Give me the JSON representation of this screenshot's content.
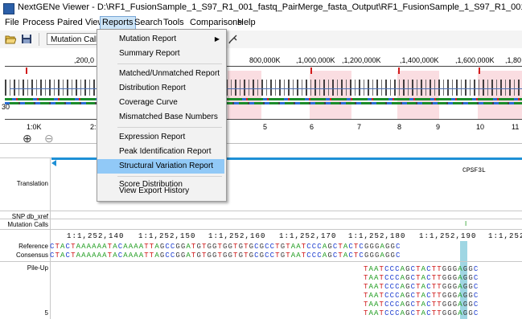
{
  "window": {
    "title": "NextGENe Viewer - D:\\RF1_FusionSample_1_S97_R1_001_fastq_PairMerge_fasta_Output\\RF1_FusionSample_1_S97_R1_001_fastq_PairMerge_fasta\\RF1_FusionSampl"
  },
  "menubar": [
    "File",
    "Process",
    "Paired View",
    "Reports",
    "Search",
    "Tools",
    "Comparisons",
    "Help"
  ],
  "toolbar": {
    "combo_value": "Mutation Call"
  },
  "reports_menu": {
    "items": [
      {
        "label": "Mutation Report",
        "submenu": true
      },
      {
        "label": "Summary Report"
      },
      {
        "label": "Matched/Unmatched Report"
      },
      {
        "label": "Distribution Report"
      },
      {
        "label": "Coverage Curve"
      },
      {
        "label": "Mismatched Base Numbers"
      },
      {
        "label": "Expression Report"
      },
      {
        "label": "Peak Identification Report"
      },
      {
        "label": "Structural Variation Report",
        "highlighted": true
      },
      {
        "label": "Score Distribution"
      },
      {
        "label": "View Export History"
      }
    ]
  },
  "overview": {
    "axis_labels": [
      ",200,0",
      "800,000K",
      ",1,000,000K",
      ",1,200,000K",
      ",1,400,000K",
      ",1,600,000K",
      ",1,80"
    ],
    "left_value": "30",
    "index_labels": [
      "1:0K",
      "2:",
      "5",
      "6",
      "7",
      "8",
      "9",
      "10",
      "11"
    ]
  },
  "tracks": {
    "translation_label": "Translation",
    "gene_label": "CPSF3L",
    "snp_label": "SNP db_xref",
    "mutation_label": "Mutation Calls",
    "mutation_marker": "I",
    "reference_label": "Reference",
    "consensus_label": "Consensus",
    "pileup_label": "Pile-Up",
    "pileup_count": "5",
    "positions": [
      "1:1,252,140",
      "1:1,252,150",
      "1:1,252,160",
      "1:1,252,170",
      "1:1,252,180",
      "1:1,252,190",
      "1:1,252"
    ],
    "reference_seq": "CTACTAAAAAATACAAAATTAGCCGGATGTGGTGGTGTGCGCCTGTAATCCCAGCTACTCGGGAGGC",
    "consensus_seq": "CTACTAAAAAATACAAAATTAGCCGGATGTGGTGGTGTGCGCCTGTAATCCCAGCTACTCGGGAGGC",
    "pileup_reads": [
      "TAATCCCAGCTACTTGGGAGGC",
      "TAATCCCAGCTACTTGGGAGGC",
      "TAATCCCAGCTACTTGGGAGGC",
      "TAATCCCAGCTACTTGGGAGGC",
      "TAATCCCAGCTACTTGGGAGGC",
      "TAATCCCAGCTACTTGGGAGGC"
    ]
  },
  "colors": {
    "A": "#1a9a1a",
    "C": "#1f3fd0",
    "G": "#3c3c3c",
    "T": "#d01c1c",
    "highlight": "#91c9f7",
    "pink": "#fadde1"
  }
}
